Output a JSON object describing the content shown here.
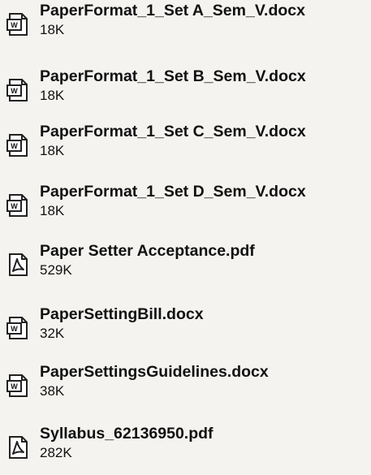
{
  "files": [
    {
      "name": "PaperFormat_1_Set A_Sem_V.docx",
      "size": "18K",
      "icon": "word-document-icon"
    },
    {
      "name": "PaperFormat_1_Set B_Sem_V.docx",
      "size": "18K",
      "icon": "word-document-icon"
    },
    {
      "name": "PaperFormat_1_Set C_Sem_V.docx",
      "size": "18K",
      "icon": "word-document-icon"
    },
    {
      "name": "PaperFormat_1_Set D_Sem_V.docx",
      "size": "18K",
      "icon": "word-document-icon"
    },
    {
      "name": "Paper Setter Acceptance.pdf",
      "size": "529K",
      "icon": "pdf-document-icon"
    },
    {
      "name": "PaperSettingBill.docx",
      "size": "32K",
      "icon": "word-document-icon"
    },
    {
      "name": "PaperSettingsGuidelines.docx",
      "size": "38K",
      "icon": "word-document-icon"
    },
    {
      "name": "Syllabus_62136950.pdf",
      "size": "282K",
      "icon": "pdf-document-icon"
    }
  ]
}
